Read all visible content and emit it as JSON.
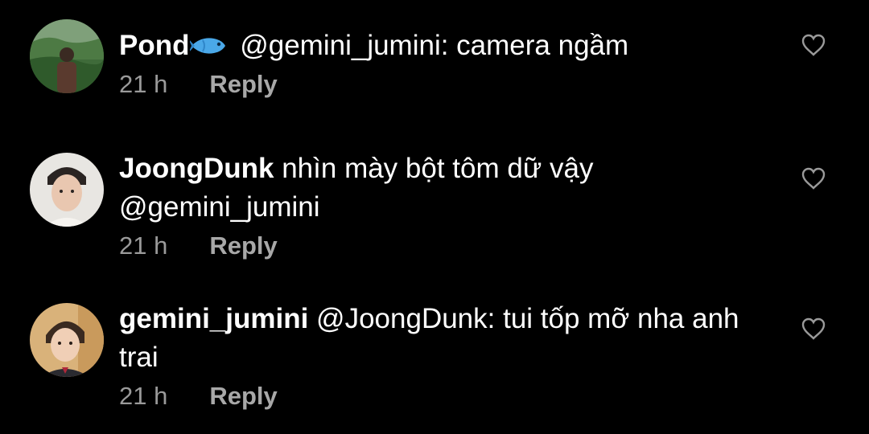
{
  "comments": [
    {
      "username": "Pond",
      "username_emoji": "fish-emoji",
      "text": "@gemini_jumini: camera ngầm",
      "time": "21 h",
      "reply_label": "Reply",
      "avatar": "avatar-forest-man"
    },
    {
      "username": "JoongDunk",
      "text": "nhìn mày bột tôm dữ vậy @gemini_jumini",
      "time": "21 h",
      "reply_label": "Reply",
      "avatar": "avatar-young-man"
    },
    {
      "username": "gemini_jumini",
      "text": "@JoongDunk: tui tốp mỡ nha anh trai",
      "time": "21 h",
      "reply_label": "Reply",
      "avatar": "avatar-child"
    }
  ],
  "colors": {
    "background": "#000000",
    "text": "#ffffff",
    "meta": "#9a9a9a",
    "heart_outline": "#9a9a9a",
    "fish": "#4aa8e8"
  }
}
